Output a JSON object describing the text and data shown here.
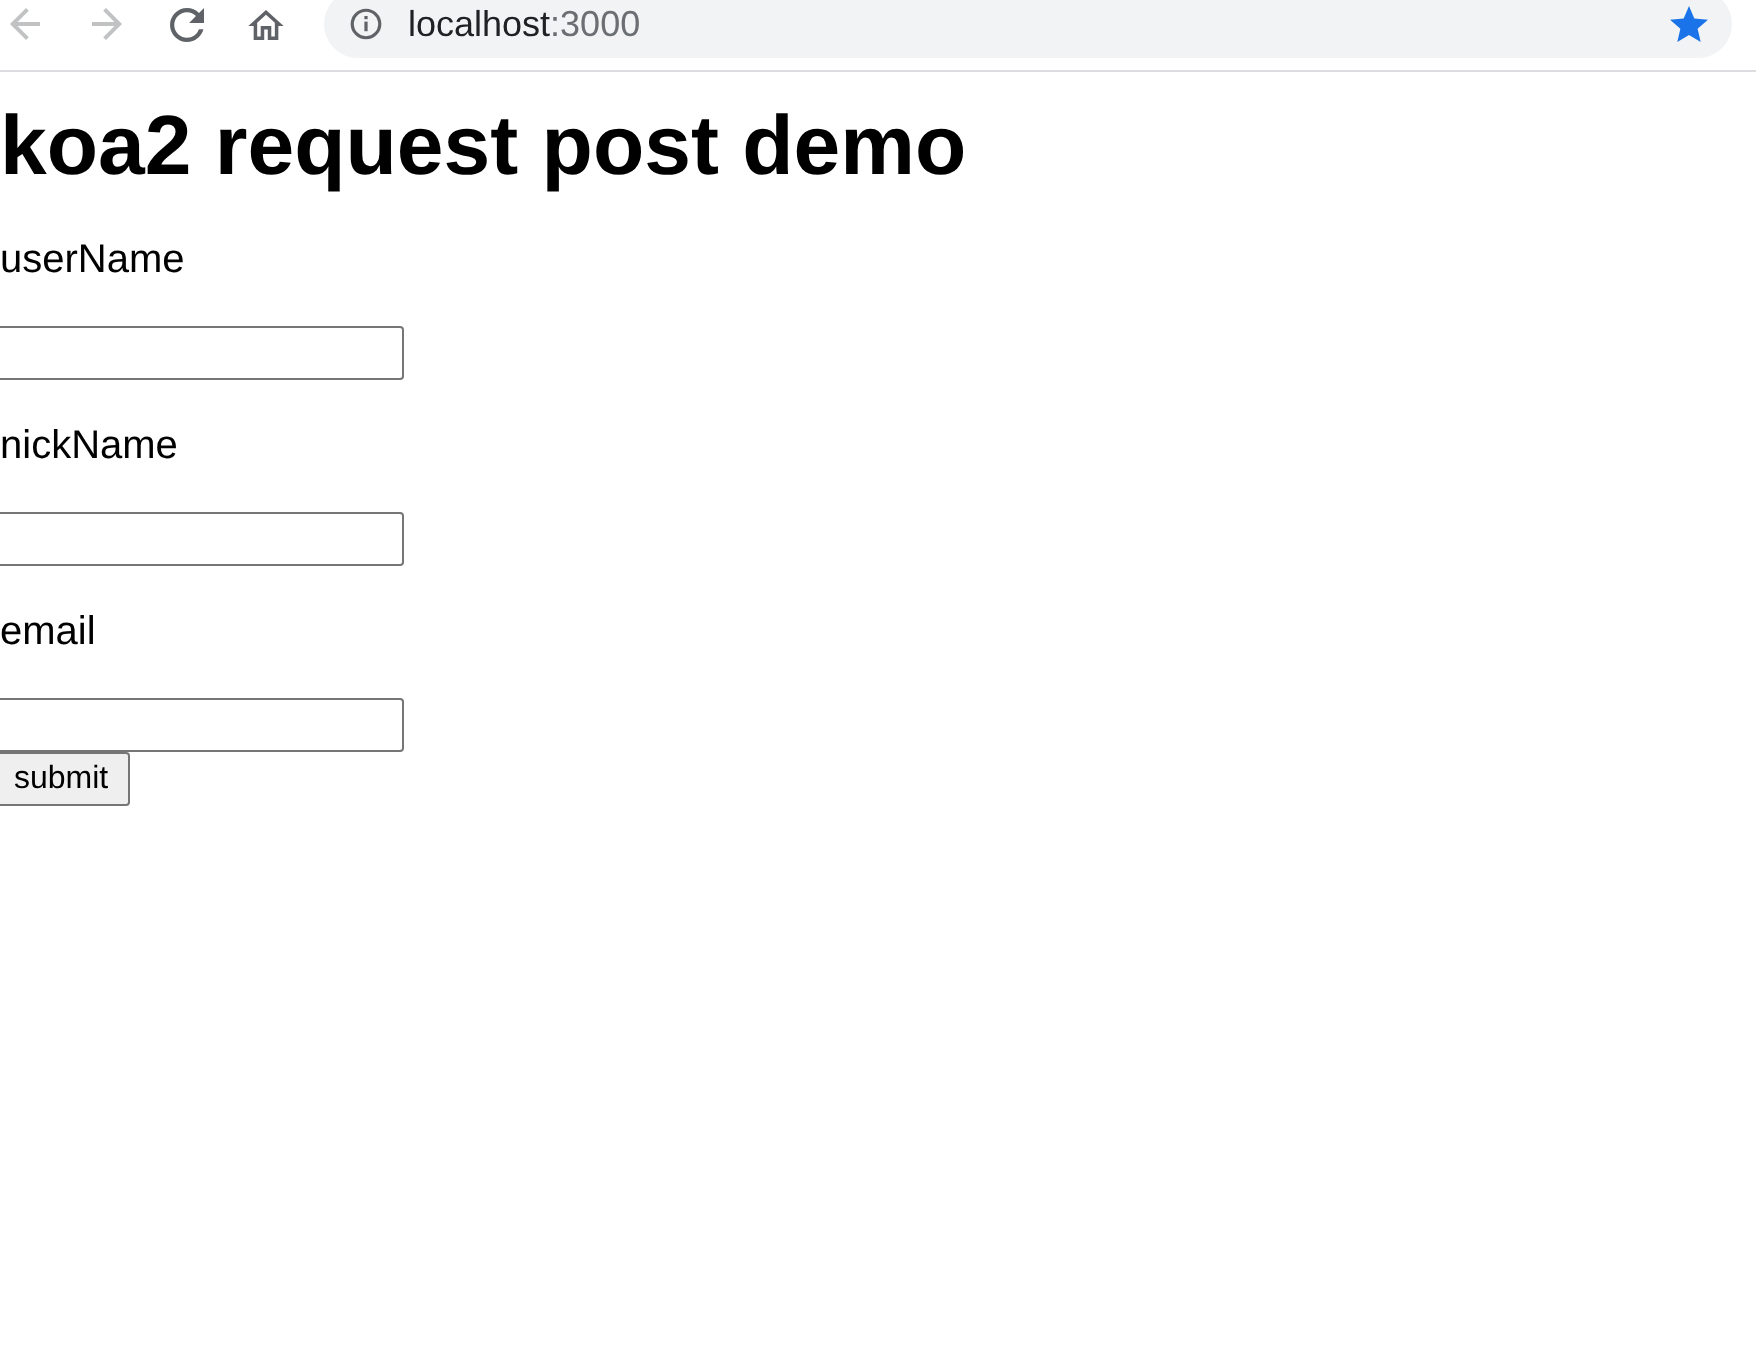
{
  "browser": {
    "nav_buttons": [
      {
        "kind": "back",
        "disabled": true
      },
      {
        "kind": "forward",
        "disabled": true
      },
      {
        "kind": "reload",
        "disabled": false
      },
      {
        "kind": "home",
        "disabled": false
      }
    ],
    "address_bar": {
      "host": "localhost",
      "port": ":3000",
      "bookmarked": true
    }
  },
  "page": {
    "heading": "koa2 request post demo",
    "fields": [
      {
        "label": "userName"
      },
      {
        "label": "nickName"
      },
      {
        "label": "email"
      }
    ],
    "submit_button": "submit"
  }
}
